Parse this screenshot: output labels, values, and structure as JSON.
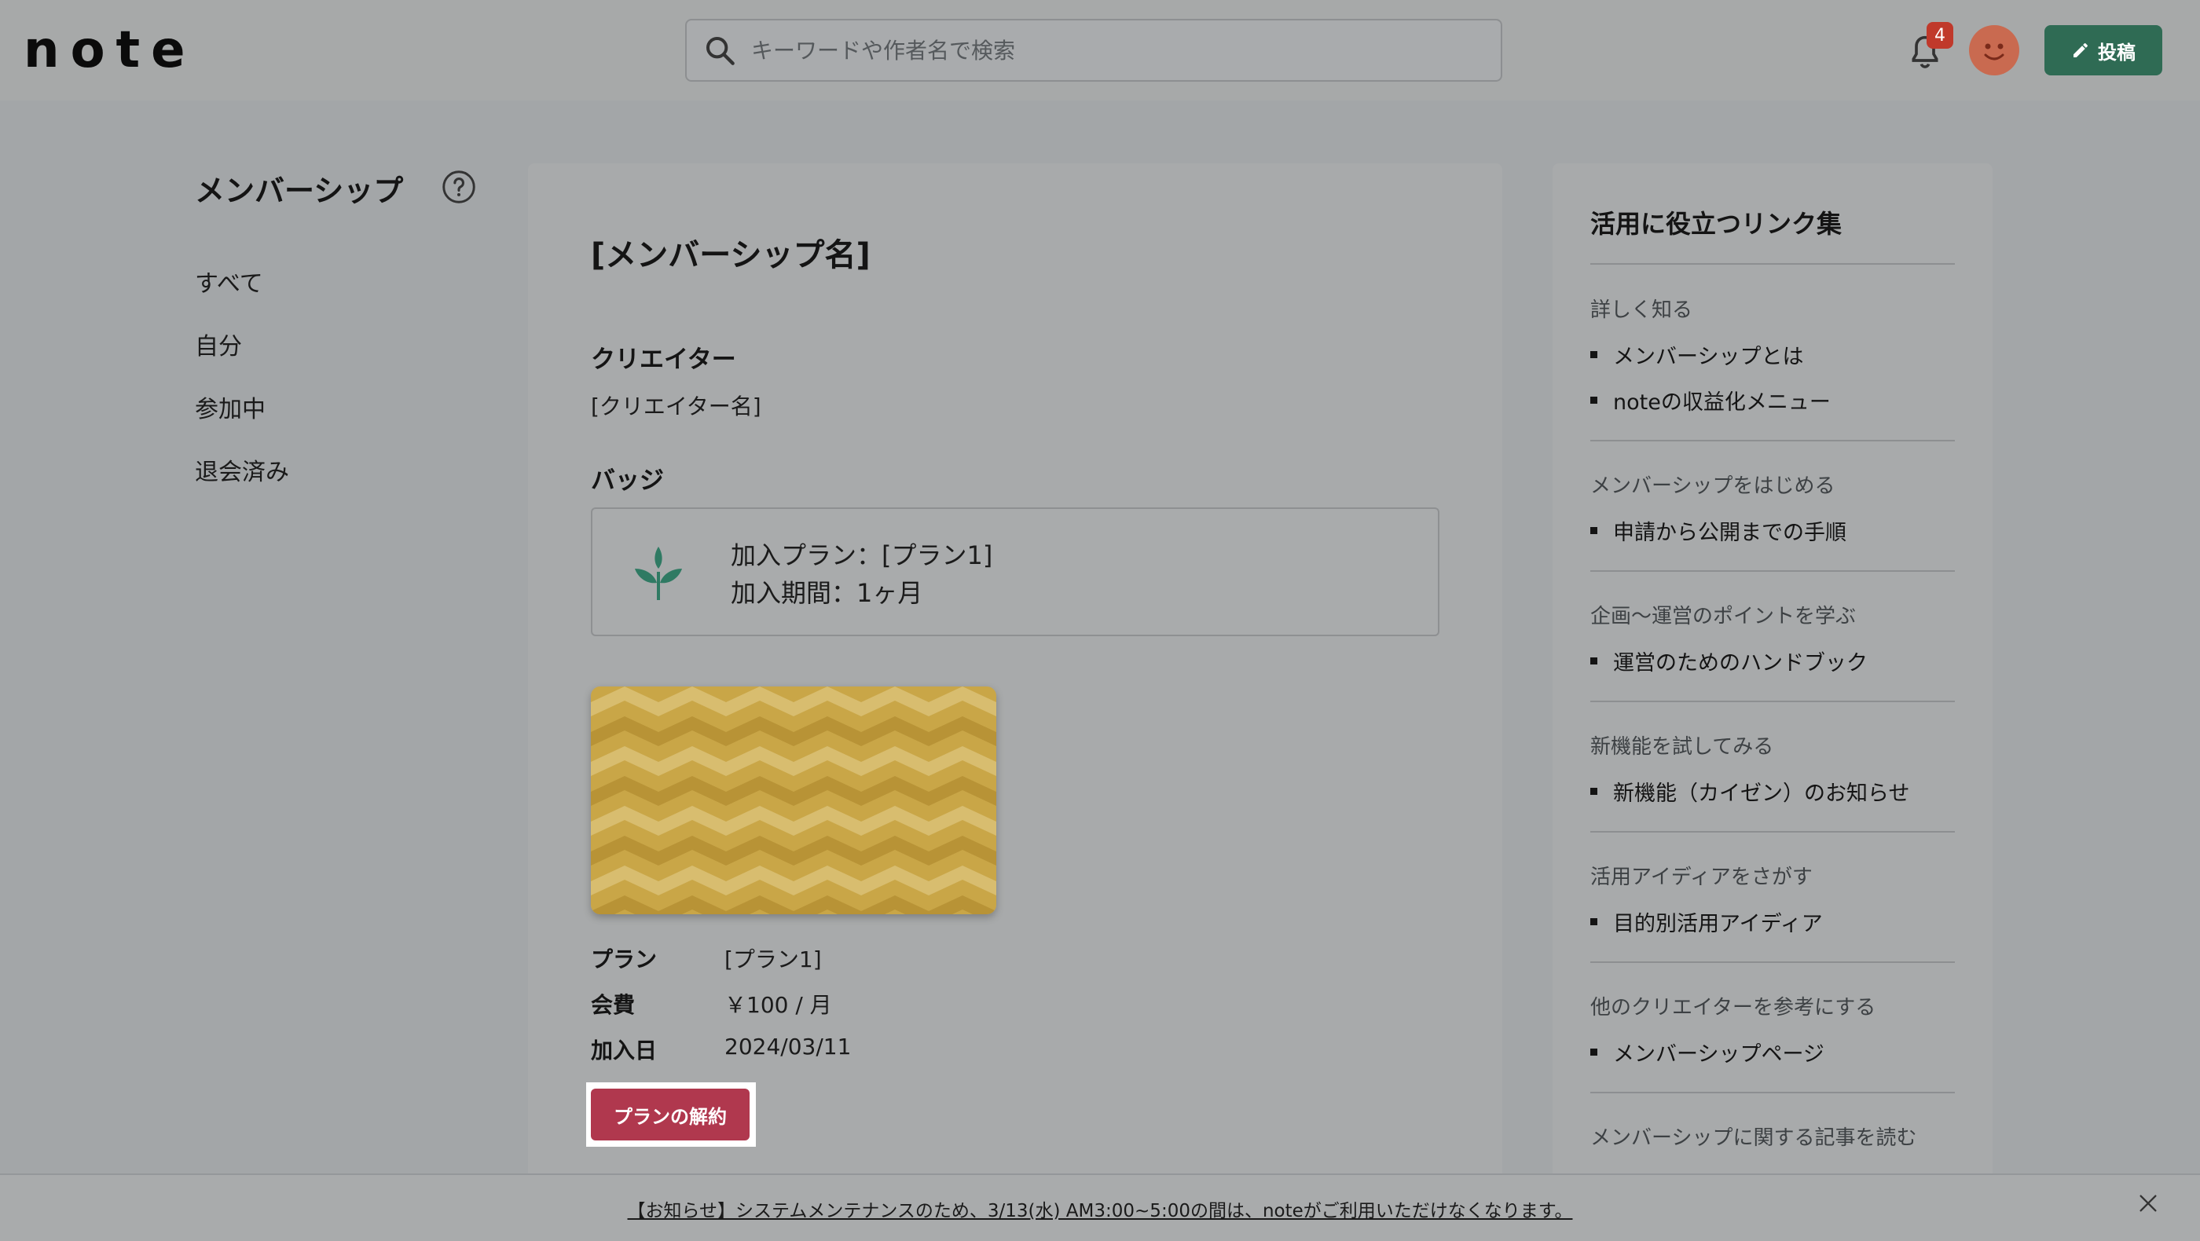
{
  "header": {
    "logo": "note",
    "search_placeholder": "キーワードや作者名で検索",
    "notification_count": "4",
    "post_label": "投稿"
  },
  "sidebar": {
    "title": "メンバーシップ",
    "items": [
      {
        "label": "すべて"
      },
      {
        "label": "自分"
      },
      {
        "label": "参加中"
      },
      {
        "label": "退会済み"
      }
    ]
  },
  "main": {
    "title": "[メンバーシップ名]",
    "creator_heading": "クリエイター",
    "creator_name": "[クリエイター名]",
    "badge_heading": "バッジ",
    "badge": {
      "plan_line": "加入プラン：[プラン1]",
      "period_line": "加入期間：1ヶ月"
    },
    "details": [
      {
        "label": "プラン",
        "value": "[プラン1]"
      },
      {
        "label": "会費",
        "value": "￥100 / 月"
      },
      {
        "label": "加入日",
        "value": "2024/03/11"
      }
    ],
    "cancel_label": "プランの解約",
    "card_colors": {
      "base": "#c9a647",
      "light": "#d8bd6f",
      "dark": "#b89336"
    }
  },
  "links": {
    "title": "活用に役立つリンク集",
    "groups": [
      {
        "heading": "詳しく知る",
        "items": [
          "メンバーシップとは",
          "noteの収益化メニュー"
        ]
      },
      {
        "heading": "メンバーシップをはじめる",
        "items": [
          "申請から公開までの手順"
        ]
      },
      {
        "heading": "企画〜運営のポイントを学ぶ",
        "items": [
          "運営のためのハンドブック"
        ]
      },
      {
        "heading": "新機能を試してみる",
        "items": [
          "新機能（カイゼン）のお知らせ"
        ]
      },
      {
        "heading": "活用アイディアをさがす",
        "items": [
          "目的別活用アイディア"
        ]
      },
      {
        "heading": "他のクリエイターを参考にする",
        "items": [
          "メンバーシップページ"
        ]
      },
      {
        "heading": "メンバーシップに関する記事を読む",
        "items": []
      }
    ]
  },
  "notice": {
    "text": "【お知らせ】システムメンテナンスのため、3/13(水) AM3:00~5:00の間は、noteがご利用いただけなくなります。"
  }
}
